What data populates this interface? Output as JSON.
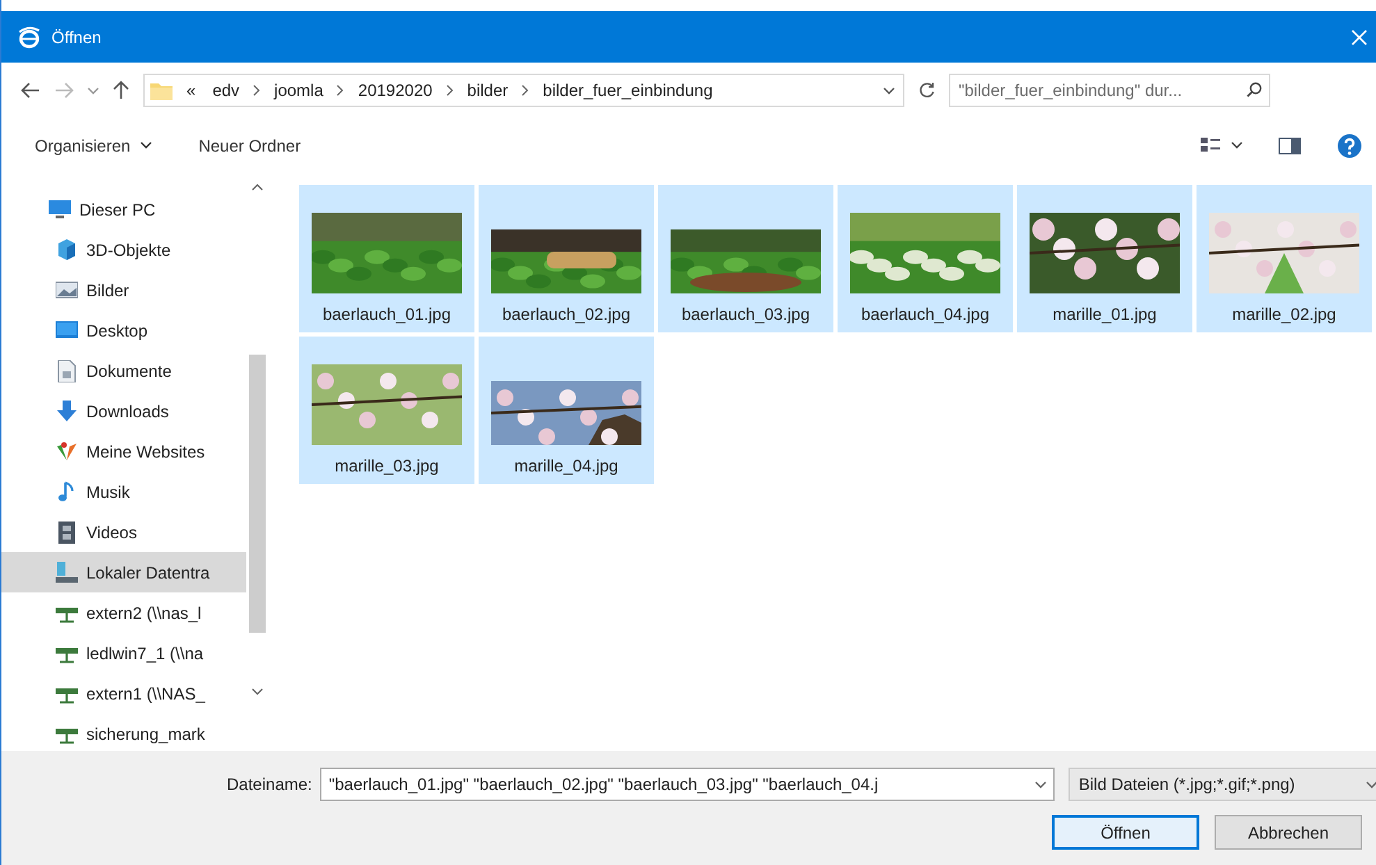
{
  "window": {
    "title": "Öffnen"
  },
  "address": {
    "crumbs": [
      "«",
      "edv",
      "joomla",
      "20192020",
      "bilder",
      "bilder_fuer_einbindung"
    ]
  },
  "search": {
    "placeholder": "\"bilder_fuer_einbindung\" dur..."
  },
  "toolbar": {
    "organize": "Organisieren",
    "new_folder": "Neuer Ordner"
  },
  "nav": {
    "items": [
      {
        "label": "Dieser PC",
        "kind": "pc",
        "selected": false,
        "children": [
          {
            "label": "3D-Objekte",
            "kind": "cube",
            "selected": false
          },
          {
            "label": "Bilder",
            "kind": "pictures",
            "selected": false
          },
          {
            "label": "Desktop",
            "kind": "desktop",
            "selected": false
          },
          {
            "label": "Dokumente",
            "kind": "documents",
            "selected": false
          },
          {
            "label": "Downloads",
            "kind": "downloads",
            "selected": false
          },
          {
            "label": "Meine Websites",
            "kind": "web",
            "selected": false
          },
          {
            "label": "Musik",
            "kind": "music",
            "selected": false
          },
          {
            "label": "Videos",
            "kind": "videos",
            "selected": false
          },
          {
            "label": "Lokaler Datentra",
            "kind": "drive",
            "selected": true
          },
          {
            "label": "extern2 (\\\\nas_l",
            "kind": "netdrive",
            "selected": false
          },
          {
            "label": "ledlwin7_1 (\\\\na",
            "kind": "netdrive",
            "selected": false
          },
          {
            "label": "extern1 (\\\\NAS_",
            "kind": "netdrive",
            "selected": false
          },
          {
            "label": "sicherung_mark",
            "kind": "netdrive",
            "selected": false
          }
        ]
      }
    ]
  },
  "files": [
    {
      "name": "baerlauch_01.jpg",
      "selected": true
    },
    {
      "name": "baerlauch_02.jpg",
      "selected": true
    },
    {
      "name": "baerlauch_03.jpg",
      "selected": true
    },
    {
      "name": "baerlauch_04.jpg",
      "selected": true
    },
    {
      "name": "marille_01.jpg",
      "selected": true
    },
    {
      "name": "marille_02.jpg",
      "selected": true
    },
    {
      "name": "marille_03.jpg",
      "selected": true
    },
    {
      "name": "marille_04.jpg",
      "selected": true
    }
  ],
  "bottom": {
    "filename_label": "Dateiname:",
    "filename": "\"baerlauch_01.jpg\" \"baerlauch_02.jpg\" \"baerlauch_03.jpg\" \"baerlauch_04.j",
    "filter": "Bild Dateien (*.jpg;*.gif;*.png)",
    "buttons": [
      {
        "label": "Öffnen",
        "kind": "default"
      },
      {
        "label": "Abbrechen",
        "kind": "normal"
      }
    ]
  }
}
